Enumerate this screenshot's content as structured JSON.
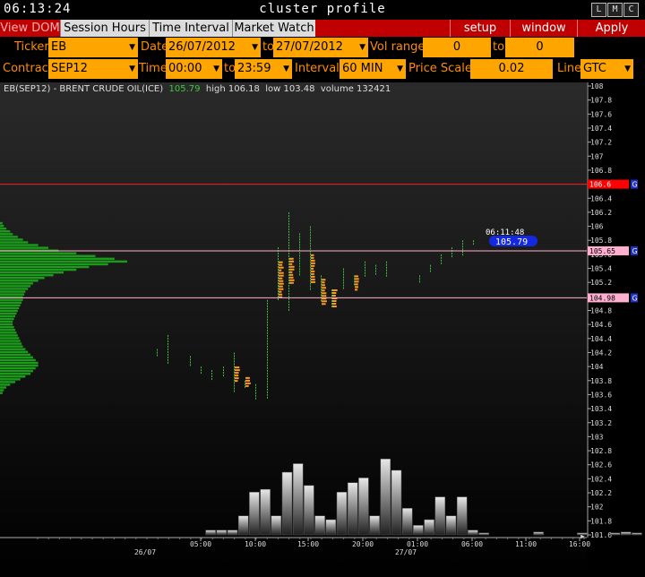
{
  "titlebar": {
    "clock": "06:13:24",
    "title": "cluster profile",
    "buttons": [
      "L",
      "M",
      "C"
    ]
  },
  "menubar": {
    "tabs": [
      "View DOM",
      "Session Hours",
      "Time Interval",
      "Market Watch"
    ],
    "buttons": [
      "setup",
      "window",
      "Apply"
    ]
  },
  "params": {
    "ticker_label": "Ticker",
    "ticker": "EB",
    "date_label": "Date",
    "date_from": "26/07/2012",
    "to_label": "to",
    "date_to": "27/07/2012",
    "volrange_label": "Vol range",
    "vol_from": "0",
    "vol_to_label": "to",
    "vol_to": "0",
    "contract_label": "Contract",
    "contract": "SEP12",
    "time_label": "Time",
    "time_from": "00:00",
    "time_to_label": "to",
    "time_to": "23:59",
    "interval_label": "Interval",
    "interval": "60 MIN",
    "pricescale_label": "Price Scale",
    "pricescale": "0.02",
    "line_label": "Line",
    "line": "GTC"
  },
  "info": {
    "instrument": "EB(SEP12) - BRENT CRUDE OIL(ICE)",
    "last": "105.79",
    "high": "high 106.18",
    "low": "low 103.48",
    "volume": "volume 132421"
  },
  "chart_data": {
    "type": "bar",
    "y_axis_labels": [
      "108",
      "107.8",
      "107.6",
      "107.4",
      "107.2",
      "107",
      "106.8",
      "106.6",
      "106.4",
      "106.2",
      "106",
      "105.8",
      "105.6",
      "105.4",
      "105.2",
      "105",
      "104.8",
      "104.6",
      "104.4",
      "104.2",
      "104",
      "103.8",
      "103.6",
      "103.4",
      "103.2",
      "103",
      "102.8",
      "102.6",
      "102.4",
      "102.2",
      "102",
      "101.8",
      "101.6"
    ],
    "x_axis_labels": [
      "05:00",
      "10:00",
      "15:00",
      "20:00",
      "01:00",
      "06:00",
      "11:00",
      "16:00"
    ],
    "date_labels": [
      "26/07",
      "27/07"
    ],
    "lines": [
      {
        "name": "red",
        "price": 106.6,
        "label": "106.6",
        "color": "#ff2020",
        "badge_bg": "#ff0000",
        "badge_fg": "#ffffff"
      },
      {
        "name": "upper-pink",
        "price": 105.65,
        "label": "105.65",
        "color": "#ffb0c8",
        "badge_bg": "#ffb0d0",
        "badge_fg": "#000000"
      },
      {
        "name": "lower-pink",
        "price": 104.98,
        "label": "104.98",
        "color": "#ffb0c8",
        "badge_bg": "#ffb0d0",
        "badge_fg": "#000000"
      }
    ],
    "current": {
      "time": "06:11:48",
      "price": "105.79"
    },
    "hourly_volume": [
      0,
      0,
      0,
      0,
      0,
      0,
      0,
      0,
      0,
      0,
      0,
      0,
      0,
      0,
      0,
      0,
      0,
      0,
      0.05,
      0.05,
      0.05,
      0.2,
      0.45,
      0.48,
      0.2,
      0.66,
      0.75,
      0.52,
      0.2,
      0.16,
      0.45,
      0.55,
      0.6,
      0.2,
      0.8,
      0.68,
      0.28,
      0.1,
      0.16,
      0.4,
      0.2,
      0.4,
      0.05,
      0.02,
      0,
      0,
      0,
      0,
      0.03,
      0,
      0,
      0,
      0.02,
      0,
      0,
      0.02,
      0.03,
      0.02,
      0,
      0,
      0.01,
      0,
      0
    ],
    "profile_volume_note": "horizontal green volume-at-price profile on left",
    "profile": [
      0.02,
      0.03,
      0.05,
      0.08,
      0.1,
      0.14,
      0.18,
      0.22,
      0.3,
      0.38,
      0.46,
      0.6,
      0.75,
      0.9,
      1.0,
      0.85,
      0.7,
      0.6,
      0.5,
      0.42,
      0.35,
      0.3,
      0.26,
      0.24,
      0.22,
      0.2,
      0.19,
      0.18,
      0.18,
      0.17,
      0.16,
      0.15,
      0.14,
      0.13,
      0.12,
      0.11,
      0.1,
      0.1,
      0.11,
      0.12,
      0.13,
      0.14,
      0.15,
      0.16,
      0.17,
      0.18,
      0.2,
      0.22,
      0.24,
      0.26,
      0.28,
      0.3,
      0.3,
      0.28,
      0.26,
      0.24,
      0.2,
      0.16,
      0.12,
      0.08,
      0.05,
      0.03,
      0.02
    ],
    "profile_price_top": 106.06,
    "profile_price_bottom": 103.6
  }
}
